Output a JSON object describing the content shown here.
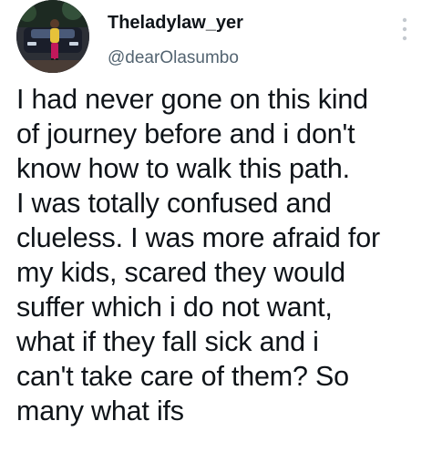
{
  "tweet": {
    "display_name": "Theladylaw_yer",
    "handle": "@dearOlasumbo",
    "icons": {
      "avatar": "profile-photo",
      "more": "more-options-icon"
    },
    "text": "I had never gone on this kind\nof journey before and i don't\nknow how to walk this path.\nI was totally confused and\nclueless. I was more afraid for\nmy kids, scared they would\nsuffer which i do not want,\nwhat if they fall sick and i\ncan't take care of them? So\nmany what ifs"
  },
  "colors": {
    "text": "#0f1419",
    "secondary_text": "#536471",
    "icon_gray": "#c4c9cf",
    "background": "#ffffff"
  }
}
